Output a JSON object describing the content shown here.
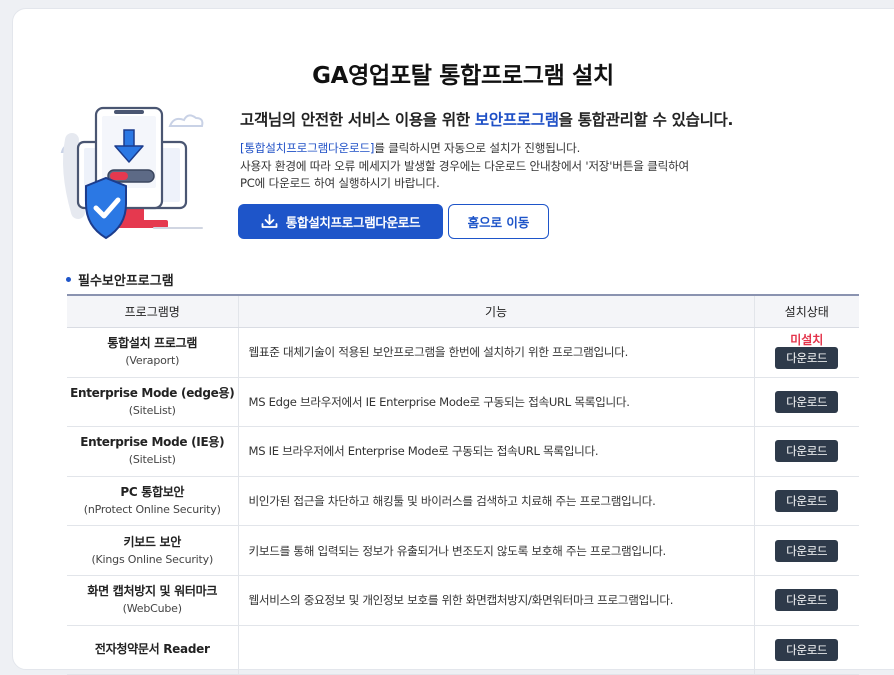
{
  "page": {
    "title": "GA영업포탈 통합프로그램 설치"
  },
  "intro": {
    "before": "고객님의 안전한 서비스 이용을 위한 ",
    "highlight": "보안프로그램",
    "after": "을 통합관리할 수 있습니다."
  },
  "description": {
    "line1_link": "[통합설치프로그램다운로드]",
    "line1_rest": "를 클릭하시면 자동으로 설치가 진행됩니다.",
    "line2": "사용자 환경에 따라 오류 메세지가 발생할 경우에는 다운로드 안내창에서 '저장'버튼을 클릭하여",
    "line3": "PC에 다운로드 하여 실행하시기 바랍니다."
  },
  "buttons": {
    "download_all": "통합설치프로그램다운로드",
    "go_home": "홈으로 이동"
  },
  "section": {
    "title": "필수보안프로그램"
  },
  "table": {
    "headers": {
      "name": "프로그램명",
      "function": "기능",
      "status": "설치상태"
    },
    "download_label": "다운로드",
    "rows": [
      {
        "name": "통합설치 프로그램",
        "sub": "(Veraport)",
        "function": "웹표준 대체기술이 적용된 보안프로그램을 한번에 설치하기 위한 프로그램입니다.",
        "status": "미설치"
      },
      {
        "name": "Enterprise Mode (edge용)",
        "sub": "(SiteList)",
        "function": "MS Edge 브라우저에서 IE Enterprise Mode로 구동되는 접속URL 목록입니다.",
        "status": ""
      },
      {
        "name": "Enterprise Mode (IE용)",
        "sub": "(SiteList)",
        "function": "MS IE 브라우저에서 Enterprise Mode로 구동되는 접속URL 목록입니다.",
        "status": ""
      },
      {
        "name": "PC 통합보안",
        "sub": "(nProtect Online Security)",
        "function": "비인가된 접근을 차단하고 해킹툴 및 바이러스를 검색하고 치료해 주는 프로그램입니다.",
        "status": ""
      },
      {
        "name": "키보드 보안",
        "sub": "(Kings Online Security)",
        "function": "키보드를 통해 입력되는 정보가 유출되거나 변조도지 않도록 보호해 주는 프로그램입니다.",
        "status": ""
      },
      {
        "name": "화면 캡처방지 및 워터마크",
        "sub": "(WebCube)",
        "function": "웹서비스의 중요정보 및 개인정보 보호를 위한 화면캡처방지/화면워터마크 프로그램입니다.",
        "status": ""
      },
      {
        "name": "전자청약문서 Reader",
        "sub": "",
        "function": "",
        "status": ""
      }
    ]
  },
  "colors": {
    "accent": "#1e55c9",
    "status_not_installed": "#e4344b",
    "download_button": "#2e3a4a"
  }
}
